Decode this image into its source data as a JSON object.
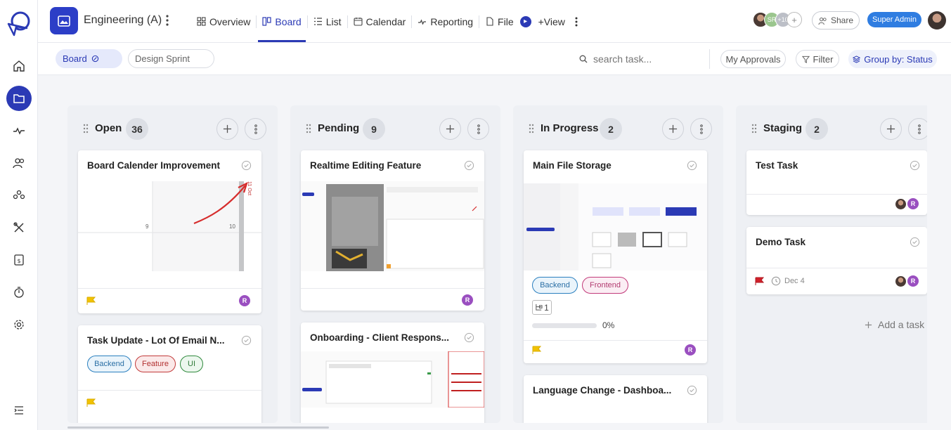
{
  "project": {
    "title": "Engineering (A)"
  },
  "nav": {
    "tabs": [
      {
        "label": "Overview",
        "icon": "grid-icon"
      },
      {
        "label": "Board",
        "icon": "board-icon",
        "active": true
      },
      {
        "label": "List",
        "icon": "list-icon"
      },
      {
        "label": "Calendar",
        "icon": "calendar-icon"
      },
      {
        "label": "Reporting",
        "icon": "reporting-icon"
      },
      {
        "label": "File",
        "icon": "file-icon"
      }
    ],
    "add_view": "+View"
  },
  "header": {
    "avatars": [
      "photo",
      "SR",
      "+10",
      "+"
    ],
    "share_label": "Share",
    "role_badge": "Super Admin"
  },
  "subbar": {
    "board_chip": "Board",
    "sprint_chip": "Design Sprint",
    "search_placeholder": "search task...",
    "approvals": "My Approvals",
    "filter": "Filter",
    "group_by": "Group by: Status"
  },
  "columns": [
    {
      "title": "Open",
      "count": "36"
    },
    {
      "title": "Pending",
      "count": "9"
    },
    {
      "title": "In Progress",
      "count": "2"
    },
    {
      "title": "Staging",
      "count": "2"
    }
  ],
  "cards": {
    "open_1": {
      "title": "Board Calender Improvement",
      "thumb_labels": [
        "9",
        "10",
        "11 Oct"
      ],
      "avatar": "R"
    },
    "open_2": {
      "title": "Task Update - Lot Of Email N...",
      "tags": [
        "Backend",
        "Feature",
        "UI"
      ]
    },
    "pending_1": {
      "title": "Realtime Editing Feature",
      "avatar": "R"
    },
    "pending_2": {
      "title": "Onboarding - Client Respons..."
    },
    "progress_1": {
      "title": "Main File Storage",
      "tags": [
        "Backend",
        "Frontend"
      ],
      "subtasks": "1",
      "progress": "0%",
      "progress_value": 0,
      "avatar": "R"
    },
    "progress_2": {
      "title": "Language Change - Dashboa..."
    },
    "staging_1": {
      "title": "Test Task",
      "avatar": "R"
    },
    "staging_2": {
      "title": "Demo Task",
      "due": "Dec 4",
      "avatar": "R"
    }
  },
  "add_task_label": "Add a task",
  "colors": {
    "primary": "#2b3ab5",
    "flag_yellow": "#f2c200",
    "flag_red": "#d0202a",
    "avatar_purple": "#9a4fc0"
  }
}
